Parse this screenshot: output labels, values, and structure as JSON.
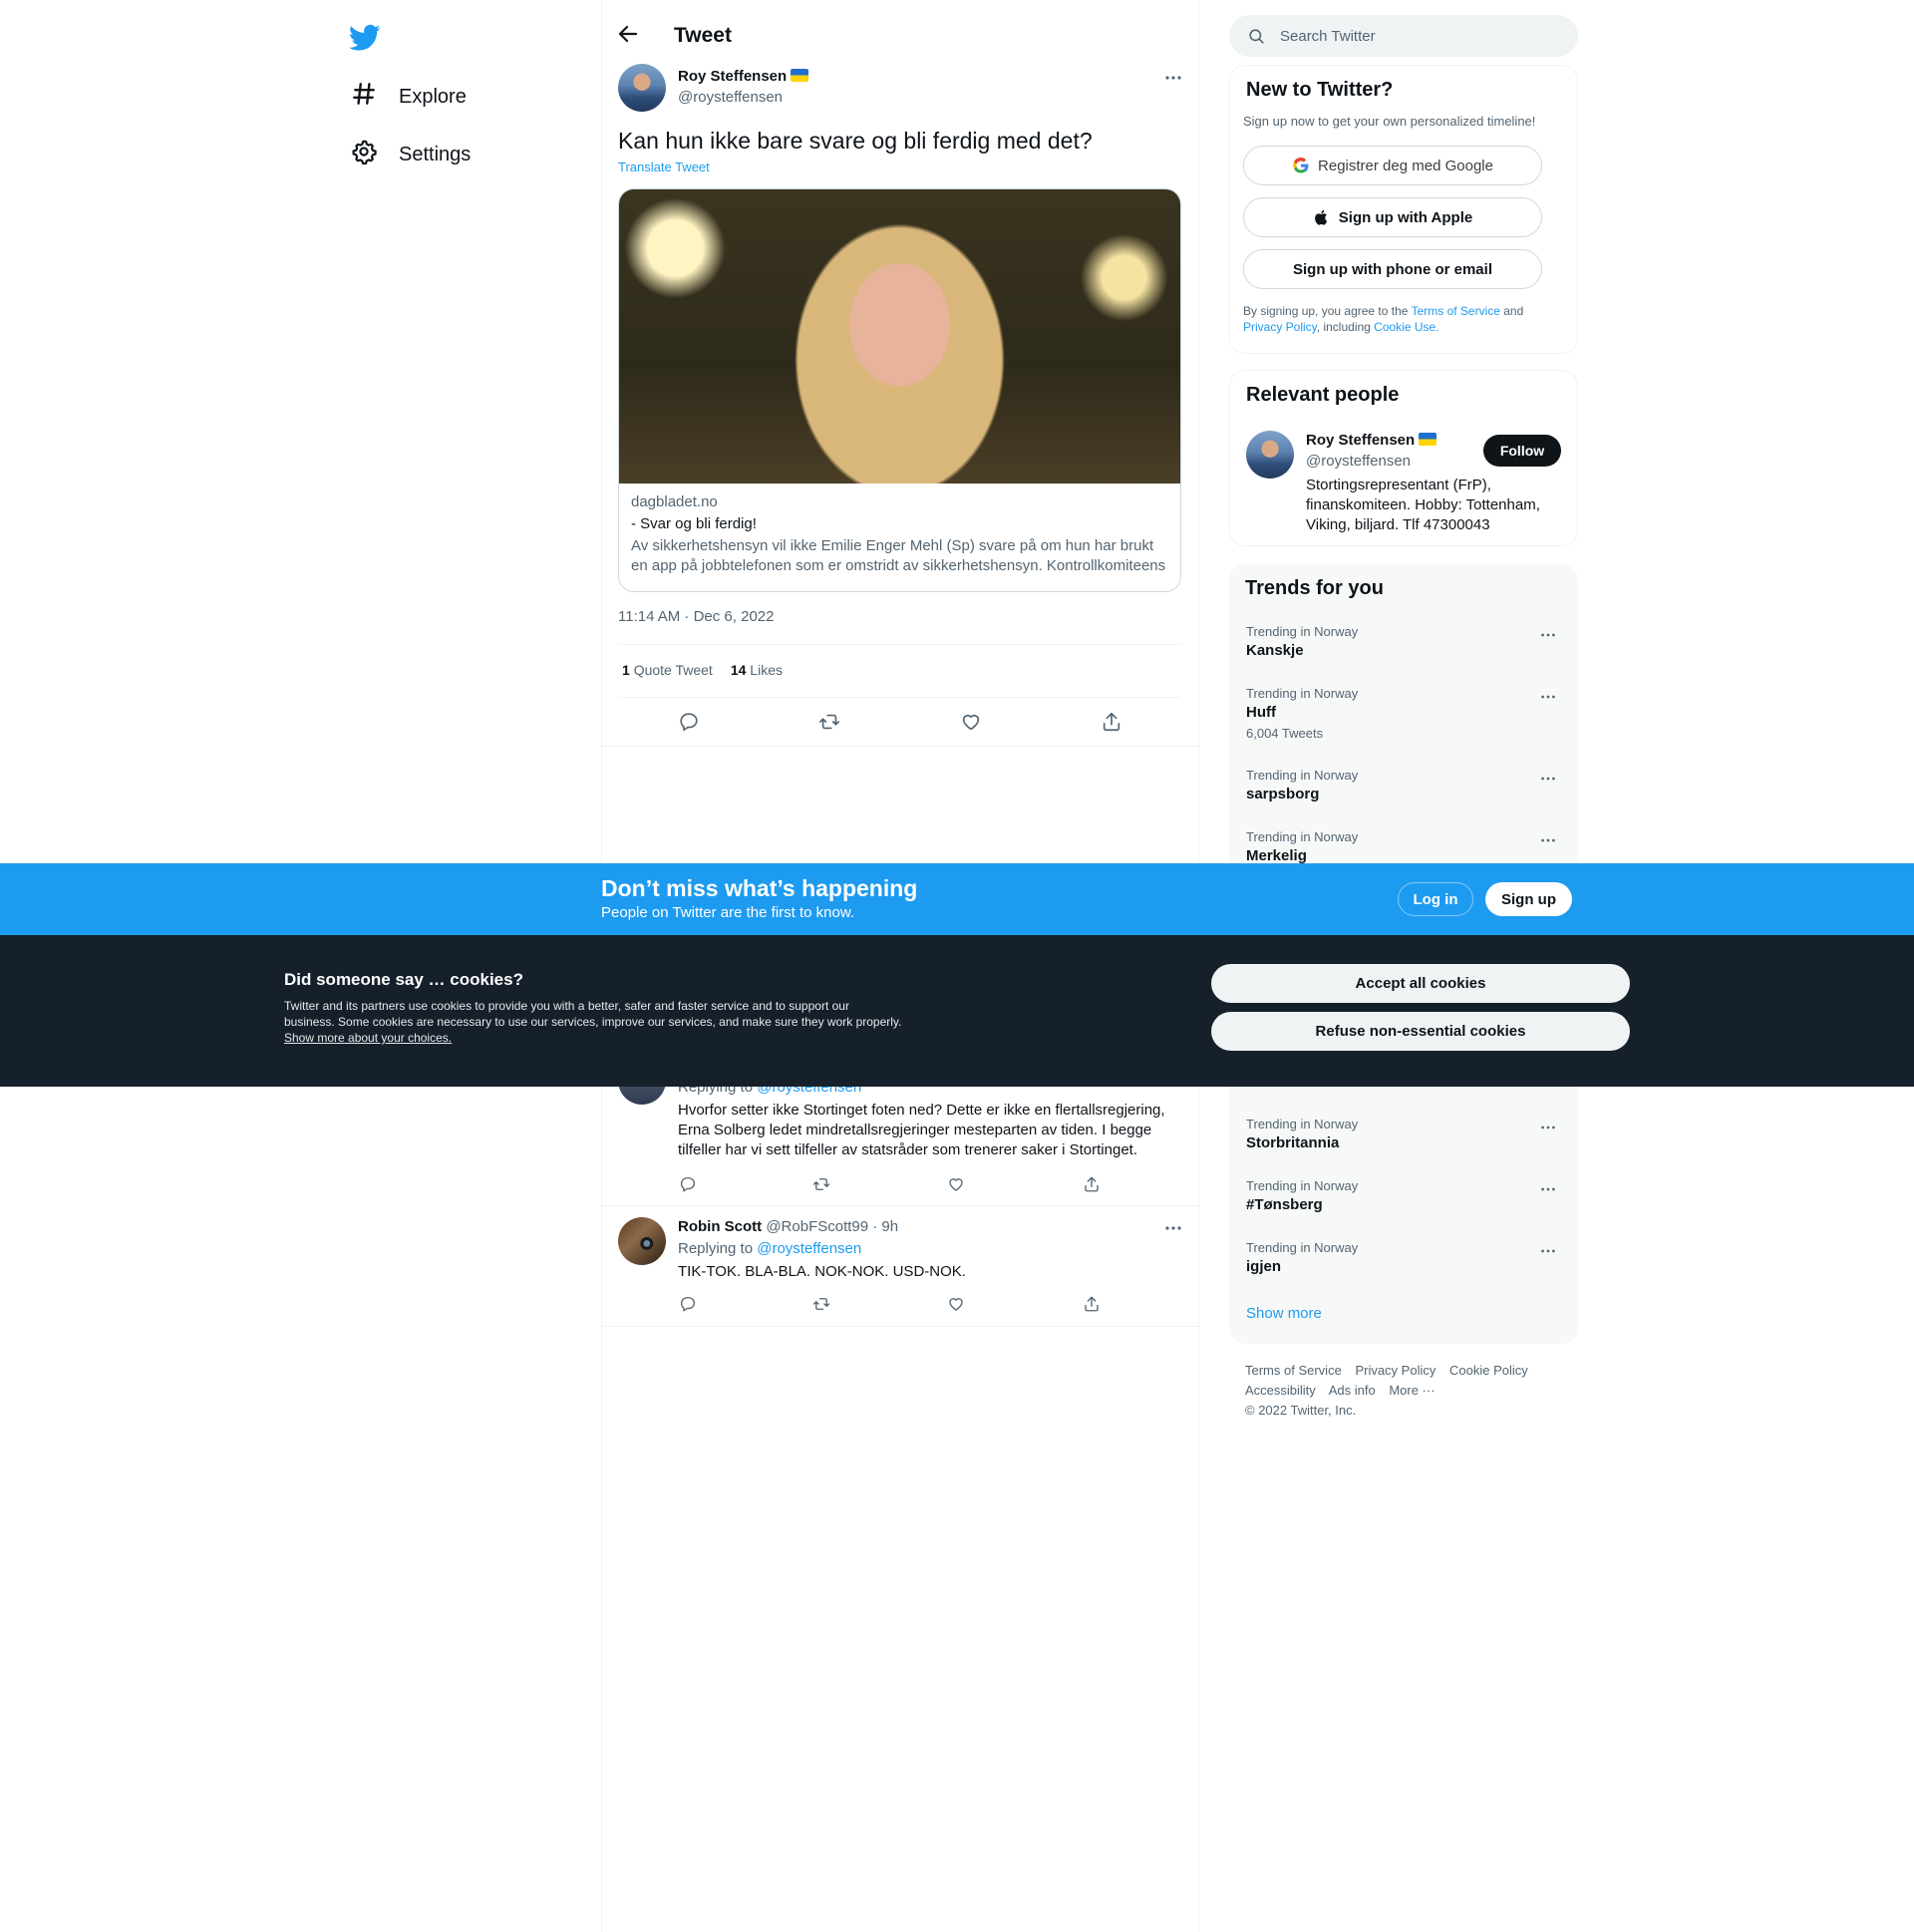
{
  "nav": {
    "logo": "twitter-bird-icon",
    "items": [
      {
        "label": "Explore",
        "icon": "hashtag-icon"
      },
      {
        "label": "Settings",
        "icon": "gear-icon"
      }
    ]
  },
  "header": {
    "title": "Tweet"
  },
  "tweet": {
    "author_name": "Roy Steffensen",
    "author_handle": "@roysteffensen",
    "text": "Kan hun ikke bare svare og bli ferdig med det?",
    "translate_label": "Translate Tweet",
    "card": {
      "domain": "dagbladet.no",
      "title": "- Svar og bli ferdig!",
      "description": "Av sikkerhetshensyn vil ikke Emilie Enger Mehl (Sp) svare på om hun har brukt en app på jobbtelefonen som er omstridt av sikkerhetshensyn. Kontrollkomiteens ..."
    },
    "timestamp": "11:14 AM · Dec 6, 2022",
    "quote_count": "1",
    "quote_label": "Quote Tweet",
    "like_count": "14",
    "like_label": "Likes"
  },
  "replies": [
    {
      "replying_label": "Replying to",
      "replying_to": "@roysteffensen",
      "text": "Hvorfor setter ikke Stortinget foten ned? Dette er ikke en flertallsregjering, Erna Solberg ledet mindretallsregjeringer mesteparten av tiden. I begge tilfeller har vi sett tilfeller av statsråder som trenerer saker i Stortinget."
    },
    {
      "name": "Robin Scott",
      "meta": "@RobFScott99 · 9h",
      "replying_label": "Replying to",
      "replying_to": "@roysteffensen",
      "text": "TIK-TOK. BLA-BLA. NOK-NOK. USD-NOK."
    }
  ],
  "search": {
    "placeholder": "Search Twitter"
  },
  "signup": {
    "title": "New to Twitter?",
    "subtitle": "Sign up now to get your own personalized timeline!",
    "google": "Registrer deg med Google",
    "apple": "Sign up with Apple",
    "phone": "Sign up with phone or email",
    "legal_1": "By signing up, you agree to the ",
    "terms": "Terms of Service",
    "legal_2": " and ",
    "privacy": "Privacy Policy",
    "legal_3": ", including ",
    "cookie_use": "Cookie Use."
  },
  "relevant": {
    "title": "Relevant people",
    "name": "Roy Steffensen",
    "handle": "@roysteffensen",
    "follow": "Follow",
    "bio": "Stortingsrepresentant (FrP), finanskomiteen. Hobby: Tottenham, Viking, biljard. Tlf 47300043"
  },
  "trends": {
    "title": "Trends for you",
    "items": [
      {
        "context": "Trending in Norway",
        "name": "Kanskje"
      },
      {
        "context": "Trending in Norway",
        "name": "Huff",
        "count": "6,004 Tweets"
      },
      {
        "context": "Trending in Norway",
        "name": "sarpsborg"
      },
      {
        "context": "Trending in Norway",
        "name": "Merkelig"
      },
      {
        "context": "Trending in Norway",
        "name": "Storbritannia"
      },
      {
        "context": "Trending in Norway",
        "name": "#Tønsberg"
      },
      {
        "context": "Trending in Norway",
        "name": "igjen"
      }
    ],
    "show_more": "Show more"
  },
  "footer": {
    "links": [
      "Terms of Service",
      "Privacy Policy",
      "Cookie Policy",
      "Accessibility",
      "Ads info",
      "More ···"
    ],
    "copyright": "© 2022 Twitter, Inc."
  },
  "banner": {
    "title": "Don’t miss what’s happening",
    "subtitle": "People on Twitter are the first to know.",
    "login": "Log in",
    "signup": "Sign up"
  },
  "cookies": {
    "title": "Did someone say … cookies?",
    "text": "Twitter and its partners use cookies to provide you with a better, safer and faster service and to support our business. Some cookies are necessary to use our services, improve our services, and make sure they work properly. ",
    "link": "Show more about your choices.",
    "accept": "Accept all cookies",
    "refuse": "Refuse non-essential cookies"
  },
  "colors": {
    "accent": "#1d9bf0",
    "dark_banner": "#15202b"
  }
}
